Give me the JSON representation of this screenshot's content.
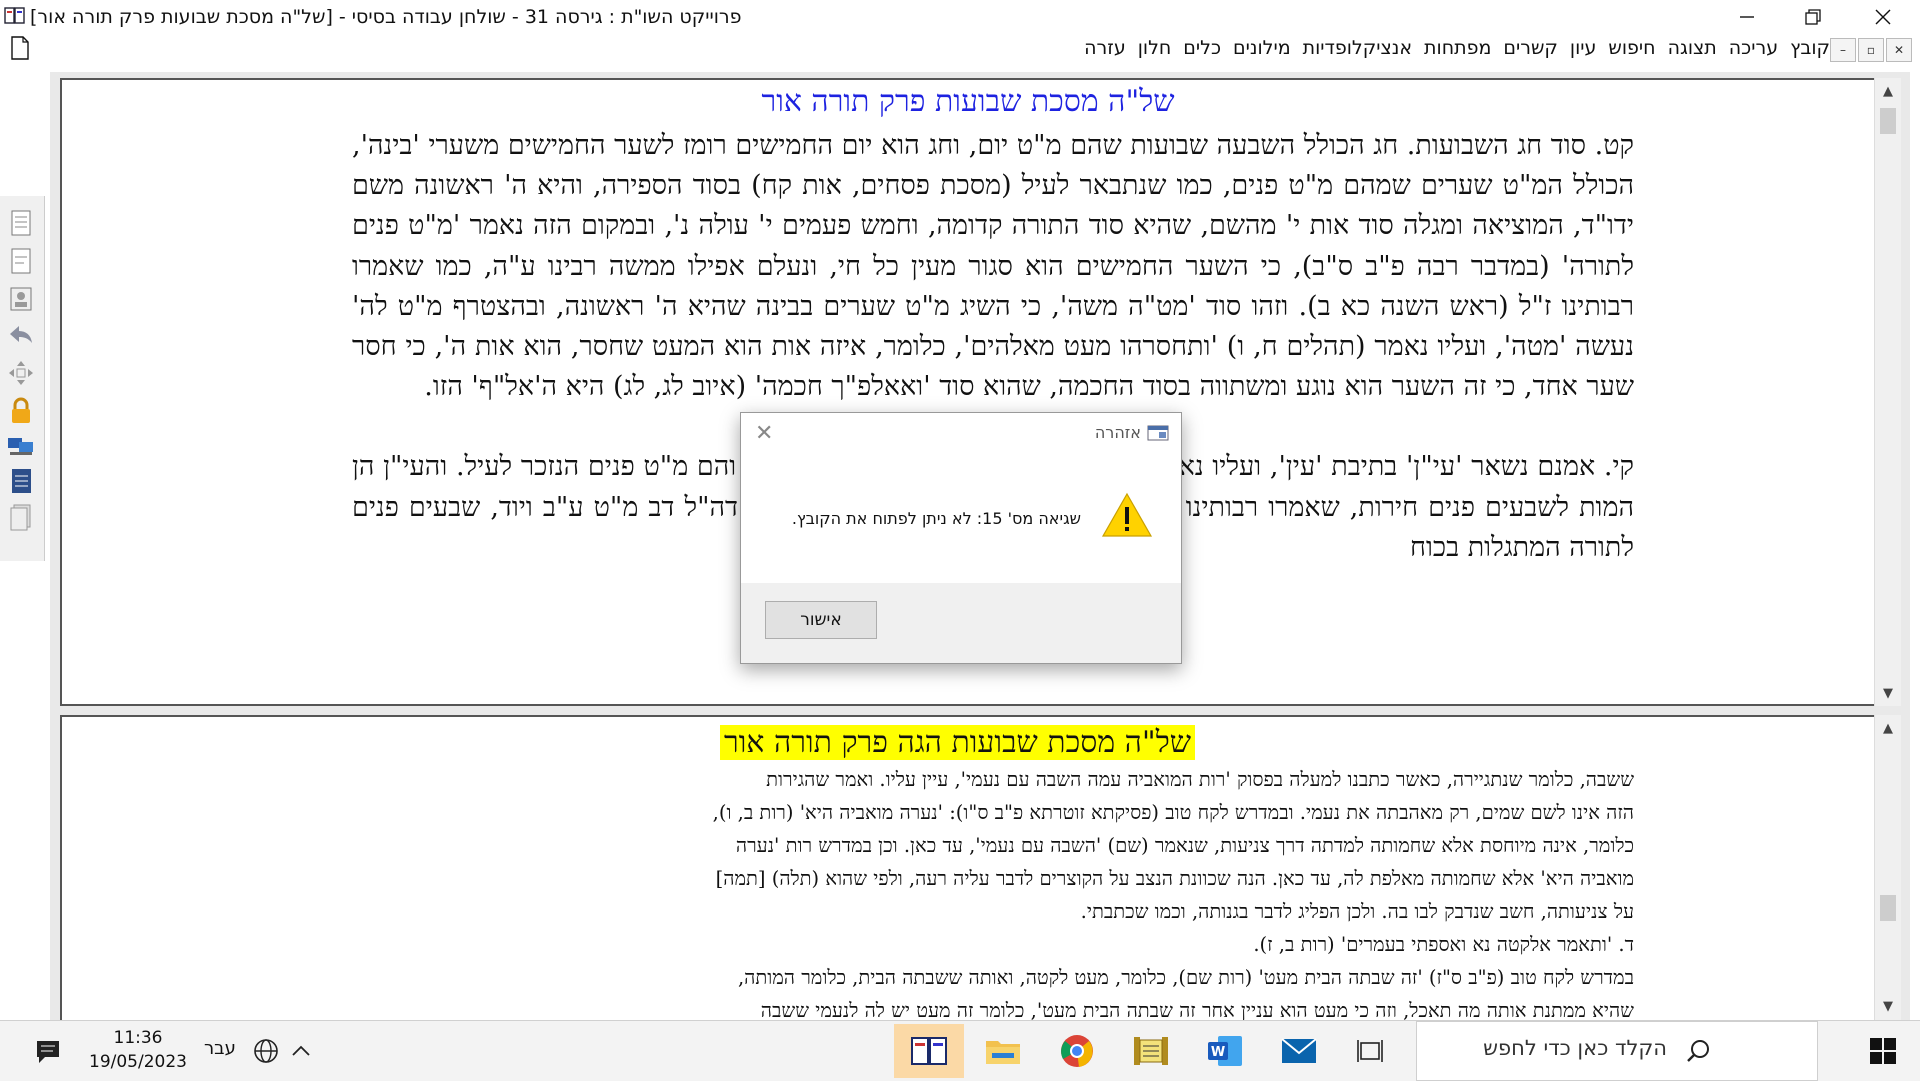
{
  "window": {
    "title": "פרוייקט השו\"ת  :  גירסה 31  - שולחן עבודה בסיסי - [של\"ה מסכת שבועות פרק תורה אור]"
  },
  "menu": {
    "items": [
      "קובץ",
      "עריכה",
      "תצוגה",
      "חיפוש",
      "עיון",
      "קשרים",
      "מפתחות",
      "אנציקלופדיות",
      "מילונים",
      "כלים",
      "חלון",
      "עזרה"
    ]
  },
  "top_pane": {
    "title": "של\"ה מסכת שבועות פרק תורה אור",
    "paragraphs": [
      "קט. סוד חג השבועות. חג הכולל השבעה שבועות שהם מ\"ט יום, וחג הוא יום החמישים רומז לשער החמישים משערי 'בינה', הכולל המ\"ט שערים שמהם מ\"ט פנים, כמו שנתבאר לעיל (מסכת פסחים, אות קח) בסוד הספירה, והיא ה' ראשונה משם ידו\"ד, המוציאה ומגלה סוד אות י' מהשם, שהיא סוד התורה קדומה, וחמש פעמים י' עולה נ', ובמקום הזה נאמר 'מ\"ט פנים לתורה' (במדבר רבה פ\"ב ס\"ב), כי השער החמישים הוא סגור מעין כל חי, ונעלם אפילו ממשה רבינו ע\"ה, כמו שאמרו רבותינו ז\"ל (ראש השנה כא ב). וזהו סוד 'מט\"ה משה', כי השיג מ\"ט שערים בבינה שהיא ה' ראשונה, ובהצטרף מ\"ט לה' נעשה 'מטה', ועליו נאמר (תהלים ח, ו) 'ותחסרהו מעט מאלהים', כלומר, איזה אות הוא המעט שחסר, הוא אות ה', כי חסר שער אחד, כי זה השער הוא נוגע ומשתווה בסוד החכמה, שהוא סוד 'ואאלפ\"ך חכמה' (איוב לג, לג) היא ה'אל\"ף' הזו.",
      "קי. אמנם נשאר 'עי\"ן' בתיבת 'עין', ועליו נאמר (ראה תקוני זהר, בהקדמה דף ז' ע\"ב), והם מ\"ט פנים הנזכר לעיל. והעי\"ן הן המות לשבעים פנים חירות, שאמרו רבותינו ז\"ל (במדבר רבה פי\"ג ס\"ט) — מ\"ע זהב דה\"ל דב מ\"ט ע\"ב ויוד, שבעים פנים לתורה המתגלות בכוח"
    ]
  },
  "bottom_pane": {
    "title": "של\"ה מסכת שבועות הגה פרק תורה אור",
    "lines": [
      "ששבה, כלומר שנתגיירה, כאשר כתבנו למעלה בפסוק 'רות המואביה עמה השבה עם נעמי', עיין עליו. ואמר שהגירות",
      "הזה אינו לשם שמים, רק מאהבתה את נעמי. ובמדרש לקח טוב (פסיקתא זוטרתא פ\"ב ס\"ו): 'נערה מואביה היא' (רות ב, ו),",
      "כלומר, אינה מיוחסת אלא שחמותה למדתה דרך צניעות, שנאמר (שם) 'השבה עם נעמי', עד כאן. וכן במדרש רות 'נערה",
      "מואביה היא' אלא שחמותה מאלפת לה, עד כאן. הנה שכוונת הנצב על הקוצרים לדבר עליה רעה, ולפי שהוא (תלה) [תמה]",
      "על צניעותה, חשב שנדבק לבו בה. ולכן הפליג לדבר בגנותה, וכמו שכתבתי.",
      "ד. 'ותאמר אלקטה נא ואספתי בעמרים' (רות ב, ז).",
      "במדרש לקח טוב (פ\"ב ס\"ז) 'זה שבתה הבית מעט' (רות שם), כלומר, מעט לקטה, ואותה ששבתה הבית, כלומר המותה,",
      "שהיא ממתנת אותה מה תאכל, וזה כי מעט הוא עניין אחר זה שבתה הבית מעט', כלומר זה מעט יש לה לנעמי ששבה"
    ]
  },
  "dialog": {
    "title": "אזהרה",
    "message": "שגיאה מס' 15: לא ניתן לפתוח את הקובץ.",
    "ok_label": "אישור"
  },
  "taskbar": {
    "search_placeholder": "הקלד כאן כדי לחפש",
    "time": "11:36",
    "date": "19/05/2023",
    "language": "עבר"
  },
  "colors": {
    "top_title": "#1d22e0",
    "bottom_title_highlight": "#ffff00",
    "warning": "#ffd200"
  }
}
